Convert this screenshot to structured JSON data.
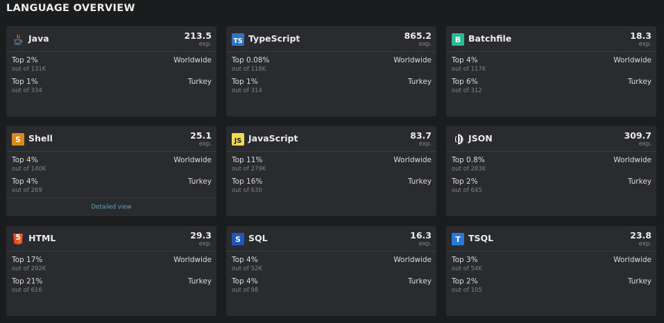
{
  "page": {
    "title": "LANGUAGE OVERVIEW"
  },
  "cards": [
    {
      "name": "Java",
      "icon": "java-icon",
      "exp": "213.5",
      "exp_label": "exp.",
      "worldwide": {
        "top": "Top 2%",
        "out_of": "out of 131K",
        "scope": "Worldwide"
      },
      "country": {
        "top": "Top 1%",
        "out_of": "out of 334",
        "scope": "Turkey"
      }
    },
    {
      "name": "TypeScript",
      "icon": "typescript-icon",
      "exp": "865.2",
      "exp_label": "exp.",
      "worldwide": {
        "top": "Top 0.08%",
        "out_of": "out of 118K",
        "scope": "Worldwide"
      },
      "country": {
        "top": "Top 1%",
        "out_of": "out of 314",
        "scope": "Turkey"
      }
    },
    {
      "name": "Batchfile",
      "icon": "batchfile-icon",
      "exp": "18.3",
      "exp_label": "exp.",
      "worldwide": {
        "top": "Top 4%",
        "out_of": "out of 117K",
        "scope": "Worldwide"
      },
      "country": {
        "top": "Top 6%",
        "out_of": "out of 312",
        "scope": "Turkey"
      }
    },
    {
      "name": "Shell",
      "icon": "shell-icon",
      "exp": "25.1",
      "exp_label": "exp.",
      "worldwide": {
        "top": "Top 4%",
        "out_of": "out of 140K",
        "scope": "Worldwide"
      },
      "country": {
        "top": "Top 4%",
        "out_of": "out of 269",
        "scope": "Turkey"
      },
      "detail_link": "Detailed view"
    },
    {
      "name": "JavaScript",
      "icon": "javascript-icon",
      "exp": "83.7",
      "exp_label": "exp.",
      "worldwide": {
        "top": "Top 11%",
        "out_of": "out of 279K",
        "scope": "Worldwide"
      },
      "country": {
        "top": "Top 16%",
        "out_of": "out of 630",
        "scope": "Turkey"
      }
    },
    {
      "name": "JSON",
      "icon": "json-icon",
      "exp": "309.7",
      "exp_label": "exp.",
      "worldwide": {
        "top": "Top 0.8%",
        "out_of": "out of 283K",
        "scope": "Worldwide"
      },
      "country": {
        "top": "Top 2%",
        "out_of": "out of 645",
        "scope": "Turkey"
      }
    },
    {
      "name": "HTML",
      "icon": "html-icon",
      "exp": "29.3",
      "exp_label": "exp.",
      "worldwide": {
        "top": "Top 17%",
        "out_of": "out of 292K",
        "scope": "Worldwide"
      },
      "country": {
        "top": "Top 21%",
        "out_of": "out of 616",
        "scope": "Turkey"
      }
    },
    {
      "name": "SQL",
      "icon": "sql-icon",
      "exp": "16.3",
      "exp_label": "exp.",
      "worldwide": {
        "top": "Top 4%",
        "out_of": "out of 52K",
        "scope": "Worldwide"
      },
      "country": {
        "top": "Top 4%",
        "out_of": "out of 98",
        "scope": "Turkey"
      }
    },
    {
      "name": "TSQL",
      "icon": "tsql-icon",
      "exp": "23.8",
      "exp_label": "exp.",
      "worldwide": {
        "top": "Top 3%",
        "out_of": "out of 54K",
        "scope": "Worldwide"
      },
      "country": {
        "top": "Top 2%",
        "out_of": "out of 105",
        "scope": "Turkey"
      }
    }
  ],
  "icons": {
    "typescript": {
      "text": "TS",
      "bg": "#2f74c0",
      "fg": "#ffffff"
    },
    "batchfile": {
      "text": "B",
      "bg": "#2fb996",
      "fg": "#ffffff"
    },
    "shell": {
      "text": "S",
      "bg": "#d98a1c",
      "fg": "#ffffff"
    },
    "javascript": {
      "text": "JS",
      "bg": "#f0db4f",
      "fg": "#1b1c1e"
    },
    "html": {
      "text": "5",
      "bg": "#e34f26",
      "fg": "#ffffff"
    },
    "sql": {
      "text": "S",
      "bg": "#1f56b8",
      "fg": "#ffffff"
    },
    "tsql": {
      "text": "T",
      "bg": "#2a78d6",
      "fg": "#ffffff"
    }
  }
}
